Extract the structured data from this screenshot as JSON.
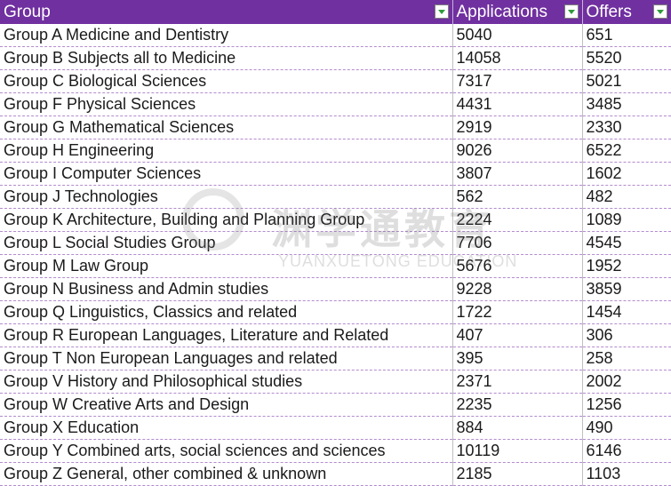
{
  "table": {
    "headers": [
      "Group",
      "Applications",
      "Offers"
    ],
    "rows": [
      [
        "Group A Medicine and Dentistry",
        "5040",
        "651"
      ],
      [
        "Group B Subjects all to Medicine",
        "14058",
        "5520"
      ],
      [
        "Group C Biological Sciences",
        "7317",
        "5021"
      ],
      [
        "Group F Physical Sciences",
        "4431",
        "3485"
      ],
      [
        "Group G Mathematical Sciences",
        "2919",
        "2330"
      ],
      [
        "Group H Engineering",
        "9026",
        "6522"
      ],
      [
        "Group I Computer Sciences",
        "3807",
        "1602"
      ],
      [
        "Group J Technologies",
        "562",
        "482"
      ],
      [
        "Group K Architecture, Building and Planning Group",
        "2224",
        "1089"
      ],
      [
        "Group L Social Studies Group",
        "7706",
        "4545"
      ],
      [
        "Group M Law Group",
        "5676",
        "1952"
      ],
      [
        "Group N Business and Admin studies",
        "9228",
        "3859"
      ],
      [
        "Group Q Linguistics, Classics and related",
        "1722",
        "1454"
      ],
      [
        "Group R European Languages, Literature and Related",
        "407",
        "306"
      ],
      [
        "Group T Non European Languages and related",
        "395",
        "258"
      ],
      [
        "Group V History and Philosophical studies",
        "2371",
        "2002"
      ],
      [
        "Group W Creative Arts and Design",
        "2235",
        "1256"
      ],
      [
        "Group X Education",
        "884",
        "490"
      ],
      [
        "Group Y Combined arts, social sciences and sciences",
        "10119",
        "6146"
      ],
      [
        "Group Z General, other combined & unknown",
        "2185",
        "1103"
      ]
    ]
  },
  "watermark": {
    "cn": "渊学通教育",
    "en": "YUANXUETONG EDUCATION"
  },
  "colors": {
    "header_bg": "#7030a0",
    "header_text": "#ffffff",
    "row_border": "#b38ccf"
  }
}
